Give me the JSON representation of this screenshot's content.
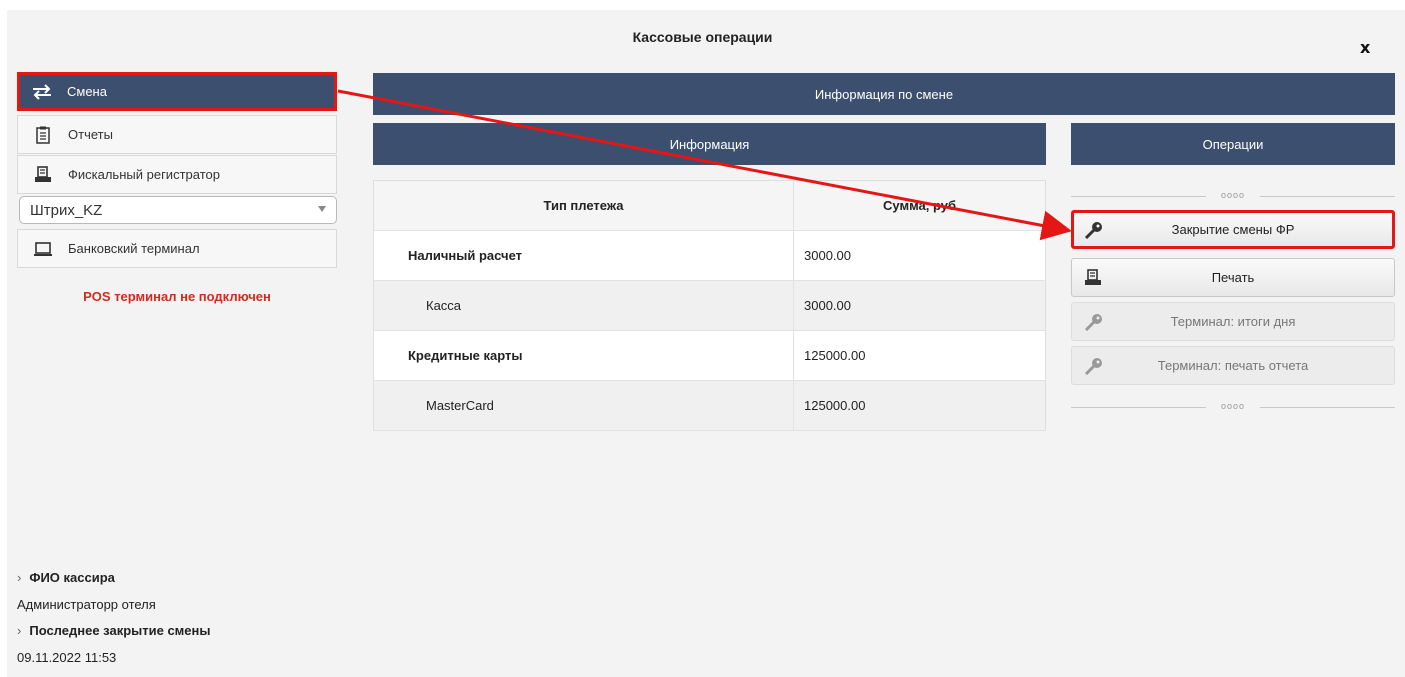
{
  "window": {
    "title": "Кассовые операции",
    "close_label": "x"
  },
  "sidebar": {
    "items": [
      {
        "label": "Смена",
        "icon": "swap-arrows-icon",
        "active": true
      },
      {
        "label": "Отчеты",
        "icon": "clipboard-icon"
      },
      {
        "label": "Фискальный регистратор",
        "icon": "printer-icon"
      },
      {
        "label": "Банковский терминал",
        "icon": "laptop-icon"
      }
    ],
    "device_select": {
      "value": "Штрих_KZ"
    },
    "pos_status": "POS терминал не подключен"
  },
  "main": {
    "header": "Информация по смене",
    "info_header": "Информация",
    "ops_header": "Операции",
    "table": {
      "columns": [
        "Тип плетежа",
        "Сумма, руб"
      ],
      "rows": [
        {
          "type": "Наличный расчет",
          "amount": "3000.00"
        },
        {
          "type": "Касса",
          "amount": "3000.00"
        },
        {
          "type": "Кредитные карты",
          "amount": "125000.00"
        },
        {
          "type": "MasterCard",
          "amount": "125000.00"
        }
      ]
    },
    "operations": [
      {
        "label": "Закрытие смены ФР",
        "icon": "key-icon",
        "enabled": true
      },
      {
        "label": "Печать",
        "icon": "printer-icon",
        "enabled": true
      },
      {
        "label": "Терминал: итоги дня",
        "icon": "key-icon",
        "enabled": false
      },
      {
        "label": "Терминал: печать отчета",
        "icon": "key-icon",
        "enabled": false
      }
    ],
    "separator_label": "oooo"
  },
  "footer": {
    "cashier_label": "ФИО кассира",
    "cashier_name": "Администраторр отеля",
    "last_close_label": "Последнее закрытие смены",
    "last_close_value": "09.11.2022 11:53"
  },
  "colors": {
    "header_bg": "#3c4f6e",
    "highlight": "#e41616",
    "status_red": "#d22b1b"
  }
}
